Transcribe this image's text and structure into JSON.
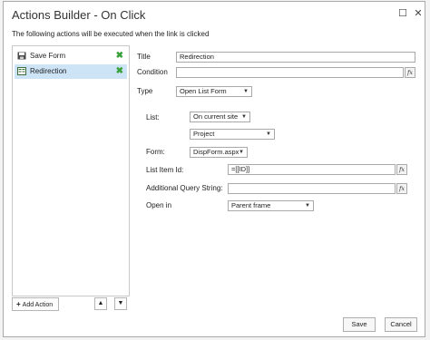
{
  "window": {
    "title": "Actions Builder - On Click",
    "subtitle": "The following actions will be executed when the link is clicked",
    "maximize_glyph": "☐",
    "close_glyph": "✕"
  },
  "actions_list": {
    "items": [
      {
        "label": "Save Form",
        "icon": "save-icon",
        "selected": false
      },
      {
        "label": "Redirection",
        "icon": "form-icon",
        "selected": true
      }
    ],
    "delete_glyph": "✖",
    "add_label": "Add Action",
    "up_glyph": "▲",
    "down_glyph": "▼"
  },
  "form": {
    "title_label": "Title",
    "title_value": "Redirection",
    "condition_label": "Condition",
    "condition_value": "",
    "type_label": "Type",
    "type_value": "Open List Form",
    "list_label": "List:",
    "list_site_value": "On current site",
    "list_value": "Project",
    "form_label": "Form:",
    "form_value": "DispForm.aspx",
    "list_item_id_label": "List Item Id:",
    "list_item_id_value": "=[[ID]]",
    "query_string_label": "Additional Query String:",
    "query_string_value": "",
    "open_in_label": "Open in",
    "open_in_value": "Parent frame",
    "fx_label": "fx"
  },
  "footer": {
    "save_label": "Save",
    "cancel_label": "Cancel"
  },
  "colors": {
    "selected_row": "#cde4f7",
    "delete_icon": "#3aa03a",
    "border": "#a9a9a9"
  }
}
